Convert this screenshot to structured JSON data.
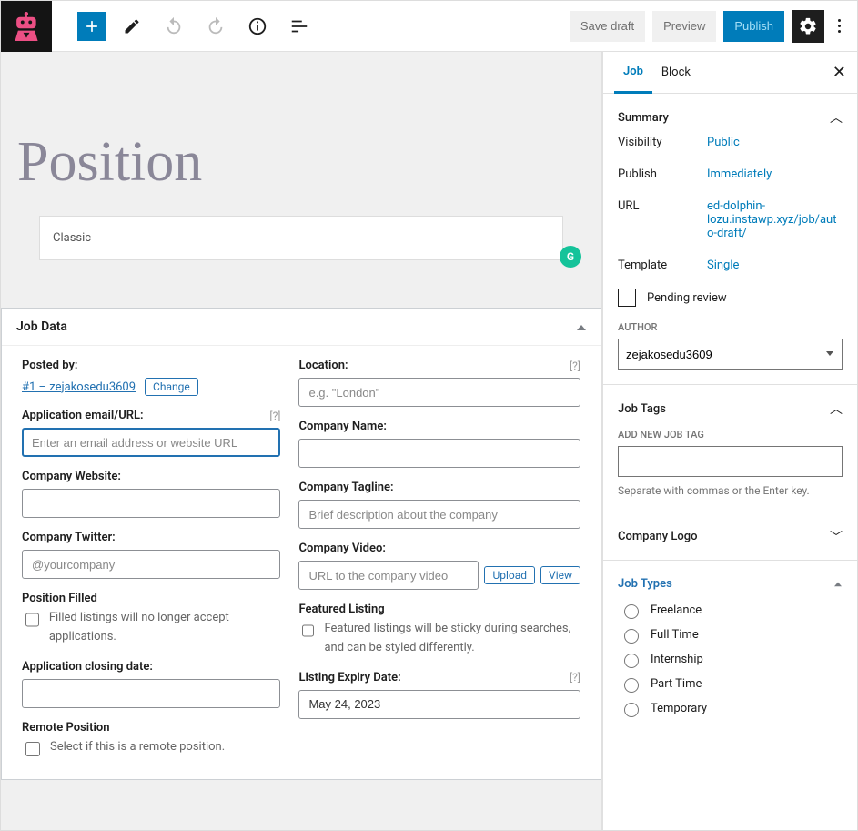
{
  "topbar": {
    "save_draft": "Save draft",
    "preview": "Preview",
    "publish": "Publish"
  },
  "editor": {
    "title_placeholder": "Position",
    "classic_block_label": "Classic"
  },
  "jobdata": {
    "title": "Job Data",
    "posted_by_label": "Posted by:",
    "posted_by_link": "#1 – zejakosedu3609",
    "change_label": "Change",
    "app_email_label": "Application email/URL:",
    "app_email_placeholder": "Enter an email address or website URL",
    "company_website_label": "Company Website:",
    "company_twitter_label": "Company Twitter:",
    "company_twitter_placeholder": "@yourcompany",
    "position_filled_label": "Position Filled",
    "position_filled_desc": "Filled listings will no longer accept applications.",
    "closing_date_label": "Application closing date:",
    "remote_label": "Remote Position",
    "remote_desc": "Select if this is a remote position.",
    "location_label": "Location:",
    "location_placeholder": "e.g. \"London\"",
    "company_name_label": "Company Name:",
    "company_tagline_label": "Company Tagline:",
    "company_tagline_placeholder": "Brief description about the company",
    "company_video_label": "Company Video:",
    "company_video_placeholder": "URL to the company video",
    "upload_label": "Upload",
    "view_label": "View",
    "featured_label": "Featured Listing",
    "featured_desc": "Featured listings will be sticky during searches, and can be styled differently.",
    "expiry_label": "Listing Expiry Date:",
    "expiry_value": "May 24, 2023",
    "help_q": "[?]"
  },
  "sidebar": {
    "tab_job": "Job",
    "tab_block": "Block",
    "summary": {
      "title": "Summary",
      "visibility_label": "Visibility",
      "visibility_value": "Public",
      "publish_label": "Publish",
      "publish_value": "Immediately",
      "url_label": "URL",
      "url_value": "ed-dolphin-lozu.instawp.xyz/job/auto-draft/",
      "template_label": "Template",
      "template_value": "Single",
      "pending_review": "Pending review",
      "author_label": "AUTHOR",
      "author_value": "zejakosedu3609"
    },
    "tags": {
      "title": "Job Tags",
      "add_new_label": "ADD NEW JOB TAG",
      "hint": "Separate with commas or the Enter key."
    },
    "company_logo": "Company Logo",
    "job_types": {
      "title": "Job Types",
      "options": [
        "Freelance",
        "Full Time",
        "Internship",
        "Part Time",
        "Temporary"
      ]
    }
  }
}
